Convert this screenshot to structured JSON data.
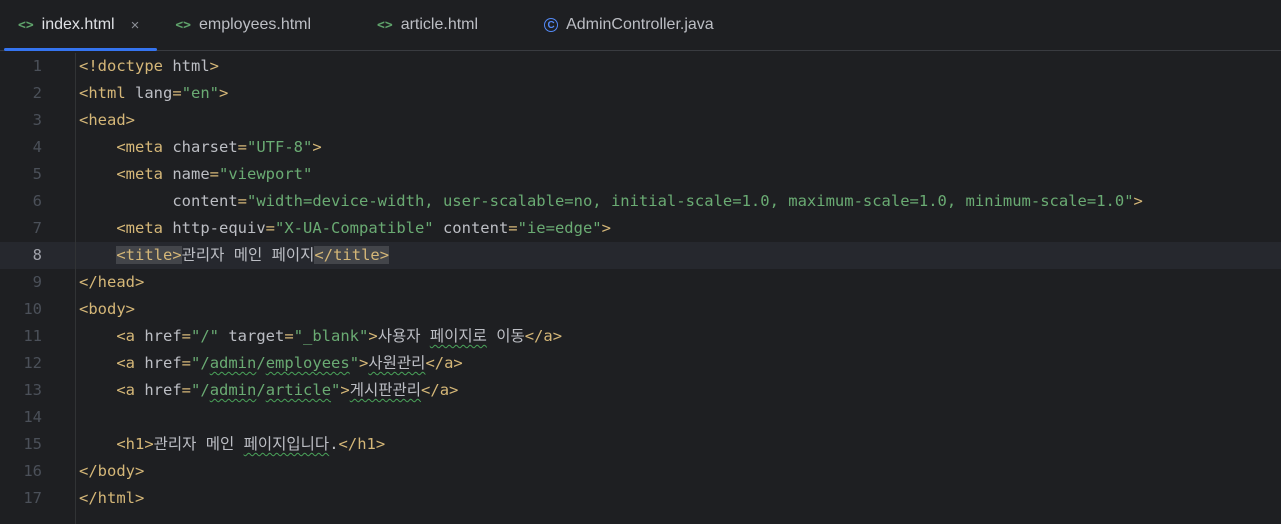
{
  "tabs": [
    {
      "label": "index.html",
      "icon": "html-file-icon",
      "active": true,
      "close": "×"
    },
    {
      "label": "employees.html",
      "icon": "html-file-icon"
    },
    {
      "label": "article.html",
      "icon": "html-file-icon"
    },
    {
      "label": "AdminController.java",
      "icon": "java-class-icon"
    }
  ],
  "icons": {
    "html": "<>",
    "java": "C"
  },
  "current_line": 8,
  "lines": [
    {
      "n": "1",
      "tokens": [
        [
          "tag",
          "<!doctype"
        ],
        [
          "attr",
          " html"
        ],
        [
          "tag",
          ">"
        ]
      ]
    },
    {
      "n": "2",
      "tokens": [
        [
          "tag",
          "<html"
        ],
        [
          "attr",
          " lang"
        ],
        [
          "tag",
          "="
        ],
        [
          "str",
          "\"en\""
        ],
        [
          "tag",
          ">"
        ]
      ]
    },
    {
      "n": "3",
      "tokens": [
        [
          "tag",
          "<head>"
        ]
      ]
    },
    {
      "n": "4",
      "tokens": [
        [
          "txt",
          "    "
        ],
        [
          "tag",
          "<meta"
        ],
        [
          "attr",
          " charset"
        ],
        [
          "tag",
          "="
        ],
        [
          "str",
          "\"UTF-8\""
        ],
        [
          "tag",
          ">"
        ]
      ]
    },
    {
      "n": "5",
      "tokens": [
        [
          "txt",
          "    "
        ],
        [
          "tag",
          "<meta"
        ],
        [
          "attr",
          " name"
        ],
        [
          "tag",
          "="
        ],
        [
          "str",
          "\"viewport\""
        ]
      ]
    },
    {
      "n": "6",
      "tokens": [
        [
          "txt",
          "          "
        ],
        [
          "attr",
          "content"
        ],
        [
          "tag",
          "="
        ],
        [
          "str",
          "\"width=device-width, user-scalable=no, initial-scale=1.0, maximum-scale=1.0, minimum-scale=1.0\""
        ],
        [
          "tag",
          ">"
        ]
      ]
    },
    {
      "n": "7",
      "tokens": [
        [
          "txt",
          "    "
        ],
        [
          "tag",
          "<meta"
        ],
        [
          "attr",
          " http-equiv"
        ],
        [
          "tag",
          "="
        ],
        [
          "str",
          "\"X-UA-Compatible\""
        ],
        [
          "attr",
          " content"
        ],
        [
          "tag",
          "="
        ],
        [
          "str",
          "\"ie=edge\""
        ],
        [
          "tag",
          ">"
        ]
      ]
    },
    {
      "n": "8",
      "tokens": [
        [
          "txt",
          "    "
        ],
        [
          "tag hl",
          "<title>"
        ],
        [
          "txt",
          "관리자 메인 페이지"
        ],
        [
          "tag hl",
          "</title>"
        ]
      ]
    },
    {
      "n": "9",
      "tokens": [
        [
          "tag",
          "</head>"
        ]
      ]
    },
    {
      "n": "10",
      "tokens": [
        [
          "tag",
          "<body>"
        ]
      ]
    },
    {
      "n": "11",
      "tokens": [
        [
          "txt",
          "    "
        ],
        [
          "tag",
          "<a"
        ],
        [
          "attr",
          " href"
        ],
        [
          "tag",
          "="
        ],
        [
          "str",
          "\"/\""
        ],
        [
          "attr",
          " target"
        ],
        [
          "tag",
          "="
        ],
        [
          "str",
          "\"_blank\""
        ],
        [
          "tag",
          ">"
        ],
        [
          "txt",
          "사용자 "
        ],
        [
          "txt under",
          "페이지로"
        ],
        [
          "txt",
          " 이동"
        ],
        [
          "tag",
          "</a>"
        ]
      ]
    },
    {
      "n": "12",
      "tokens": [
        [
          "txt",
          "    "
        ],
        [
          "tag",
          "<a"
        ],
        [
          "attr",
          " href"
        ],
        [
          "tag",
          "="
        ],
        [
          "str",
          "\"/"
        ],
        [
          "str under",
          "admin"
        ],
        [
          "str",
          "/"
        ],
        [
          "str under",
          "employees"
        ],
        [
          "str",
          "\""
        ],
        [
          "tag",
          ">"
        ],
        [
          "txt under",
          "사원관리"
        ],
        [
          "tag",
          "</a>"
        ]
      ]
    },
    {
      "n": "13",
      "tokens": [
        [
          "txt",
          "    "
        ],
        [
          "tag",
          "<a"
        ],
        [
          "attr",
          " href"
        ],
        [
          "tag",
          "="
        ],
        [
          "str",
          "\"/"
        ],
        [
          "str under",
          "admin"
        ],
        [
          "str",
          "/"
        ],
        [
          "str under",
          "article"
        ],
        [
          "str",
          "\""
        ],
        [
          "tag",
          ">"
        ],
        [
          "txt under",
          "게시판관리"
        ],
        [
          "tag",
          "</a>"
        ]
      ]
    },
    {
      "n": "14",
      "tokens": []
    },
    {
      "n": "15",
      "tokens": [
        [
          "txt",
          "    "
        ],
        [
          "tag",
          "<h1>"
        ],
        [
          "txt",
          "관리자 메인 "
        ],
        [
          "txt under",
          "페이지입니다"
        ],
        [
          "txt",
          "."
        ],
        [
          "tag",
          "</h1>"
        ]
      ]
    },
    {
      "n": "16",
      "tokens": [
        [
          "tag",
          "</body>"
        ]
      ]
    },
    {
      "n": "17",
      "tokens": [
        [
          "tag",
          "</html>"
        ]
      ]
    }
  ]
}
